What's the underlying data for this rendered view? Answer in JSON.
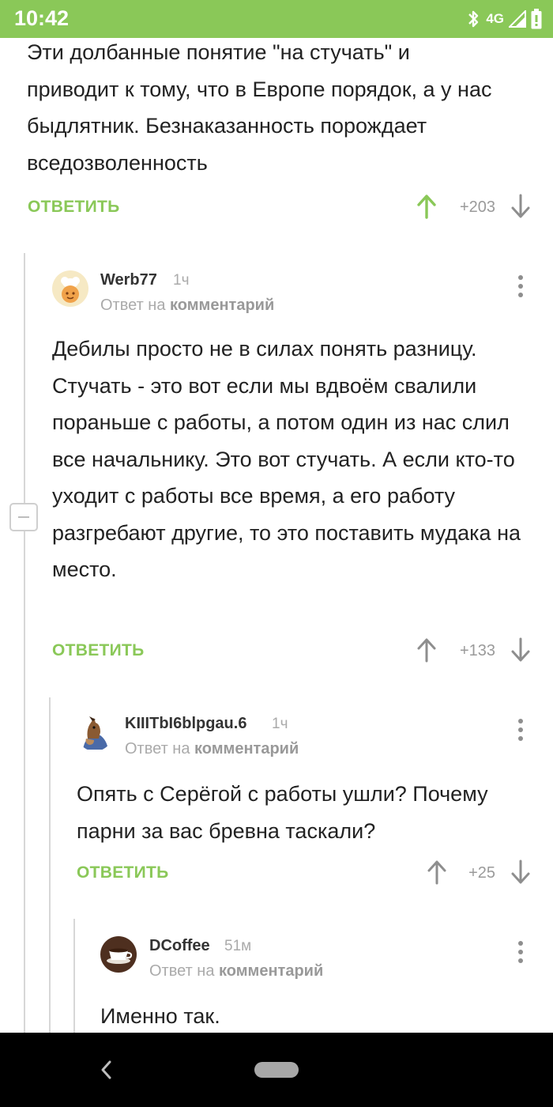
{
  "status_bar": {
    "time": "10:42",
    "network": "4G",
    "icons": [
      "bluetooth-icon",
      "signal-icon",
      "battery-icon"
    ]
  },
  "colors": {
    "accent": "#8ac858",
    "upvote": "#8ac858",
    "muted": "#aaaaaa"
  },
  "comments": [
    {
      "text": "Эти долбанные понятие \"на стучать\" и приводит к тому, что в Европе порядок, а у нас быдлятник. Безнаказанность порождает вседозволенность",
      "reply_label": "ОТВЕТИТЬ",
      "score": "+203",
      "upvoted": true
    },
    {
      "username": "Werb77",
      "time": "1ч",
      "reply_prefix": "Ответ на",
      "reply_target": "комментарий",
      "text": "Дебилы просто не в силах понять разницу. Стучать - это вот если мы вдвоём свалили пораньше с работы, а потом один из нас слил все начальнику. Это вот стучать. А если кто-то уходит с работы все время, а его работу разгребают другие, то это поставить мудака на место.",
      "reply_label": "ОТВЕТИТЬ",
      "score": "+133",
      "avatar": "chef-avatar"
    },
    {
      "username": "KIIITbI6blpgau.6",
      "time": "1ч",
      "reply_prefix": "Ответ на",
      "reply_target": "комментарий",
      "text": "Опять с Серёгой с работы ушли? Почему парни за вас бревна таскали?",
      "reply_label": "ОТВЕТИТЬ",
      "score": "+25",
      "avatar": "horse-avatar"
    },
    {
      "username": "DCoffee",
      "time": "51м",
      "reply_prefix": "Ответ на",
      "reply_target": "комментарий",
      "text": "Именно так.",
      "avatar": "coffee-cup-avatar"
    }
  ],
  "nav_bar": {
    "icons": [
      "back-icon",
      "home-pill-icon"
    ]
  }
}
